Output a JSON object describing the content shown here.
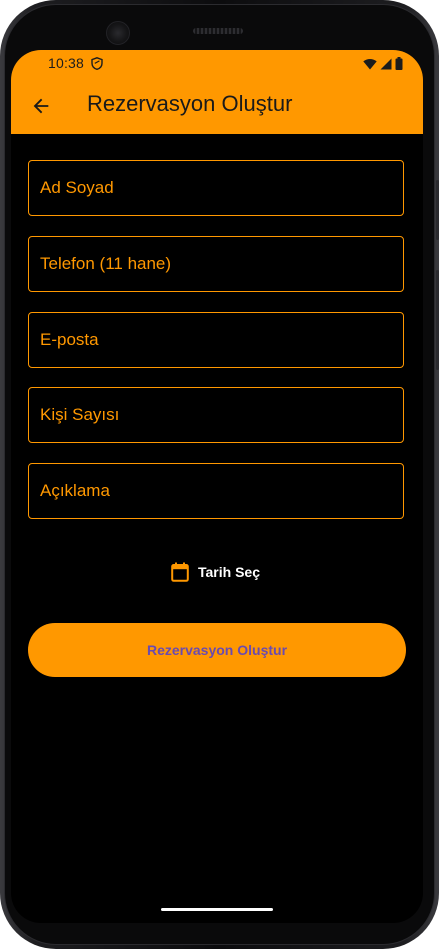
{
  "status_bar": {
    "time": "10:38",
    "icons": [
      "shield-icon",
      "wifi-icon",
      "signal-icon",
      "battery-icon"
    ]
  },
  "app_bar": {
    "title": "Rezervasyon Oluştur",
    "back_icon": "arrow-back-icon",
    "background": "#ff9800"
  },
  "form": {
    "fields": [
      {
        "name": "name-field",
        "placeholder": "Ad Soyad",
        "value": ""
      },
      {
        "name": "phone-field",
        "placeholder": "Telefon (11 hane)",
        "value": ""
      },
      {
        "name": "email-field",
        "placeholder": "E-posta",
        "value": ""
      },
      {
        "name": "guest-count-field",
        "placeholder": "Kişi Sayısı",
        "value": ""
      },
      {
        "name": "description-field",
        "placeholder": "Açıklama",
        "value": ""
      }
    ],
    "date_button": {
      "label": "Tarih Seç",
      "icon": "calendar-icon"
    },
    "submit_button": {
      "label": "Rezervasyon Oluştur"
    }
  },
  "colors": {
    "accent": "#ff9800",
    "background": "#000000",
    "submit_text": "#6a4bb0"
  }
}
